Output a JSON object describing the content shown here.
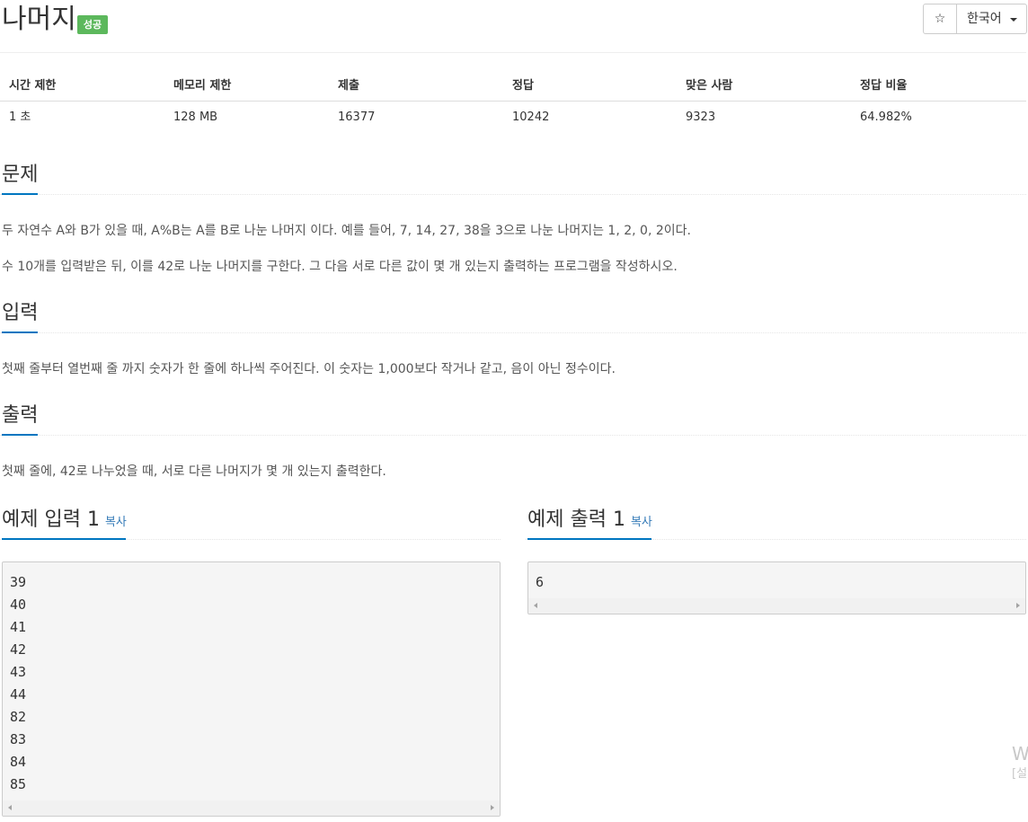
{
  "header": {
    "title": "나머지",
    "status_badge": "성공",
    "star_label": "☆",
    "language_label": "한국어"
  },
  "stats": {
    "headers": [
      "시간 제한",
      "메모리 제한",
      "제출",
      "정답",
      "맞은 사람",
      "정답 비율"
    ],
    "values": [
      "1 초",
      "128 MB",
      "16377",
      "10242",
      "9323",
      "64.982%"
    ]
  },
  "problem": {
    "heading": "문제",
    "paragraphs": [
      "두 자연수 A와 B가 있을 때, A%B는 A를 B로 나눈 나머지 이다. 예를 들어, 7, 14, 27, 38을 3으로 나눈 나머지는 1, 2, 0, 2이다.",
      "수 10개를 입력받은 뒤, 이를 42로 나눈 나머지를 구한다. 그 다음 서로 다른 값이 몇 개 있는지 출력하는 프로그램을 작성하시오."
    ]
  },
  "input": {
    "heading": "입력",
    "text": "첫째 줄부터 열번째 줄 까지 숫자가 한 줄에 하나씩 주어진다. 이 숫자는 1,000보다 작거나 같고, 음이 아닌 정수이다."
  },
  "output": {
    "heading": "출력",
    "text": "첫째 줄에, 42로 나누었을 때, 서로 다른 나머지가 몇 개 있는지 출력한다."
  },
  "sample_input": {
    "heading": "예제 입력 1",
    "copy_label": "복사",
    "lines": [
      "39",
      "40",
      "41",
      "42",
      "43",
      "44",
      "82",
      "83",
      "84",
      "85"
    ]
  },
  "sample_output": {
    "heading": "예제 출력 1",
    "copy_label": "복사",
    "lines": [
      "6"
    ]
  },
  "watermark": {
    "line1": "W",
    "line2": "[설"
  },
  "colors": {
    "accent": "#0076c0",
    "success": "#5cb85c",
    "link": "#337ab7"
  }
}
